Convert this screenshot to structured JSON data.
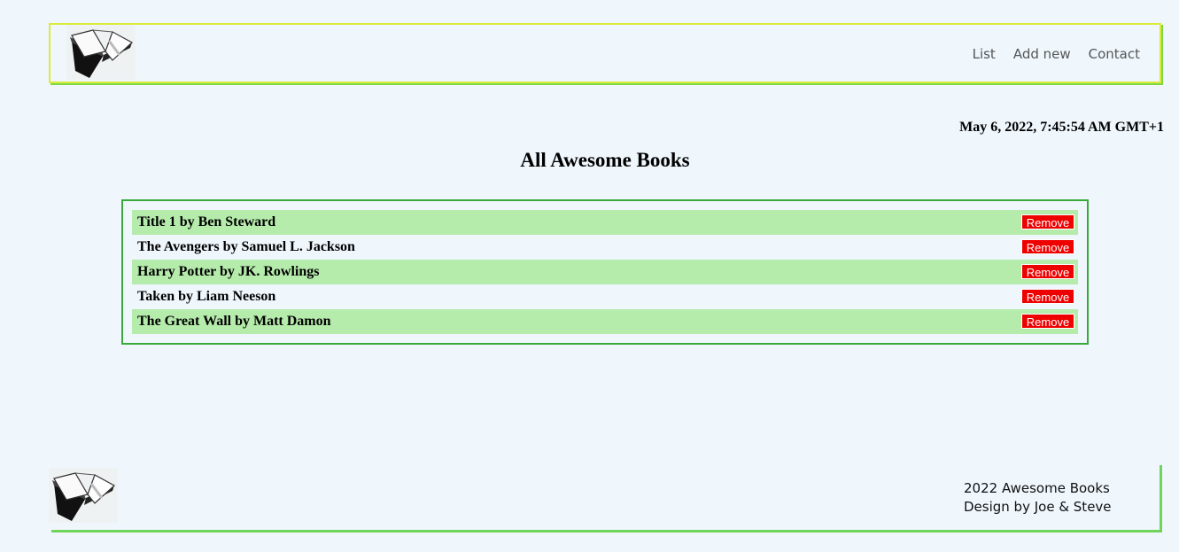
{
  "header": {
    "logo_icon": "open-book-icon",
    "nav": [
      "List",
      "Add new",
      "Contact"
    ]
  },
  "datetime": "May 6, 2022, 7:45:54 AM GMT+1",
  "title": "All Awesome Books",
  "books": [
    {
      "text": "Title 1 by Ben Steward",
      "button": "Remove"
    },
    {
      "text": "The Avengers by Samuel L. Jackson",
      "button": "Remove"
    },
    {
      "text": "Harry Potter by JK. Rowlings",
      "button": "Remove"
    },
    {
      "text": "Taken by Liam Neeson",
      "button": "Remove"
    },
    {
      "text": "The Great Wall by Matt Damon",
      "button": "Remove"
    }
  ],
  "footer": {
    "logo_icon": "open-book-icon",
    "line1": "2022 Awesome Books",
    "line2": "Design by Joe & Steve"
  },
  "colors": {
    "background": "#eff7fd",
    "header_border": "#dbeb3c",
    "accent_green": "#7ed846",
    "list_border": "#3aa83a",
    "row_highlight": "#b5ebab",
    "remove_button": "#ee0000"
  }
}
